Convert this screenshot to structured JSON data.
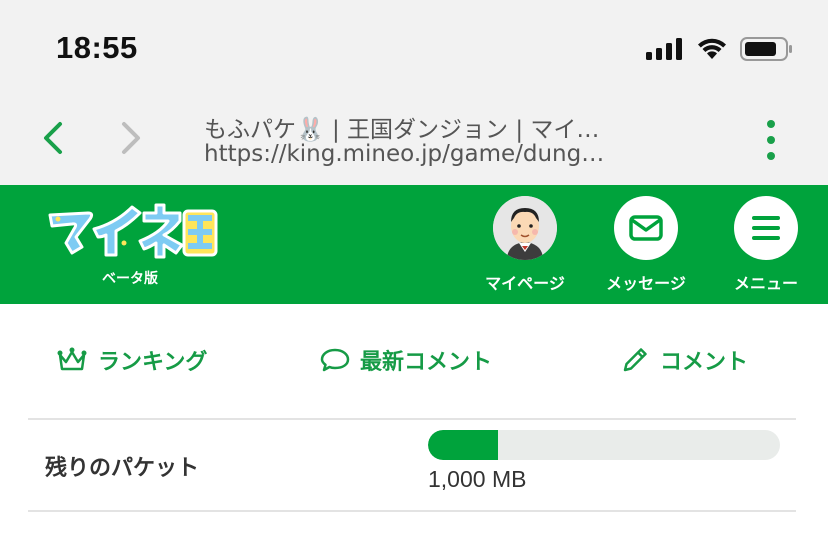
{
  "status_bar": {
    "time": "18:55",
    "signal_icon": "cellular-signal-icon",
    "wifi_icon": "wifi-icon",
    "battery_icon": "battery-icon"
  },
  "browser": {
    "back_icon": "chevron-left-icon",
    "forward_icon": "chevron-right-icon",
    "page_title": "もふパケ🐰 | 王国ダンジョン | マイ…",
    "url": "https://king.mineo.jp/game/dung…",
    "menu_icon": "vertical-ellipsis-icon",
    "accent": "#19a04a"
  },
  "header": {
    "logo_text": "マイネ王",
    "logo_subtitle": "ベータ版",
    "buttons": [
      {
        "label": "マイページ",
        "icon": "avatar-icon"
      },
      {
        "label": "メッセージ",
        "icon": "envelope-icon"
      },
      {
        "label": "メニュー",
        "icon": "hamburger-icon"
      }
    ],
    "background": "#00a33c"
  },
  "links": [
    {
      "label": "ランキング",
      "icon": "crown-icon"
    },
    {
      "label": "最新コメント",
      "icon": "speech-bubble-icon"
    },
    {
      "label": "コメント",
      "icon": "pencil-icon"
    }
  ],
  "packet": {
    "label": "残りのパケット",
    "value": "1,000 MB",
    "fill_fraction": 0.2
  }
}
